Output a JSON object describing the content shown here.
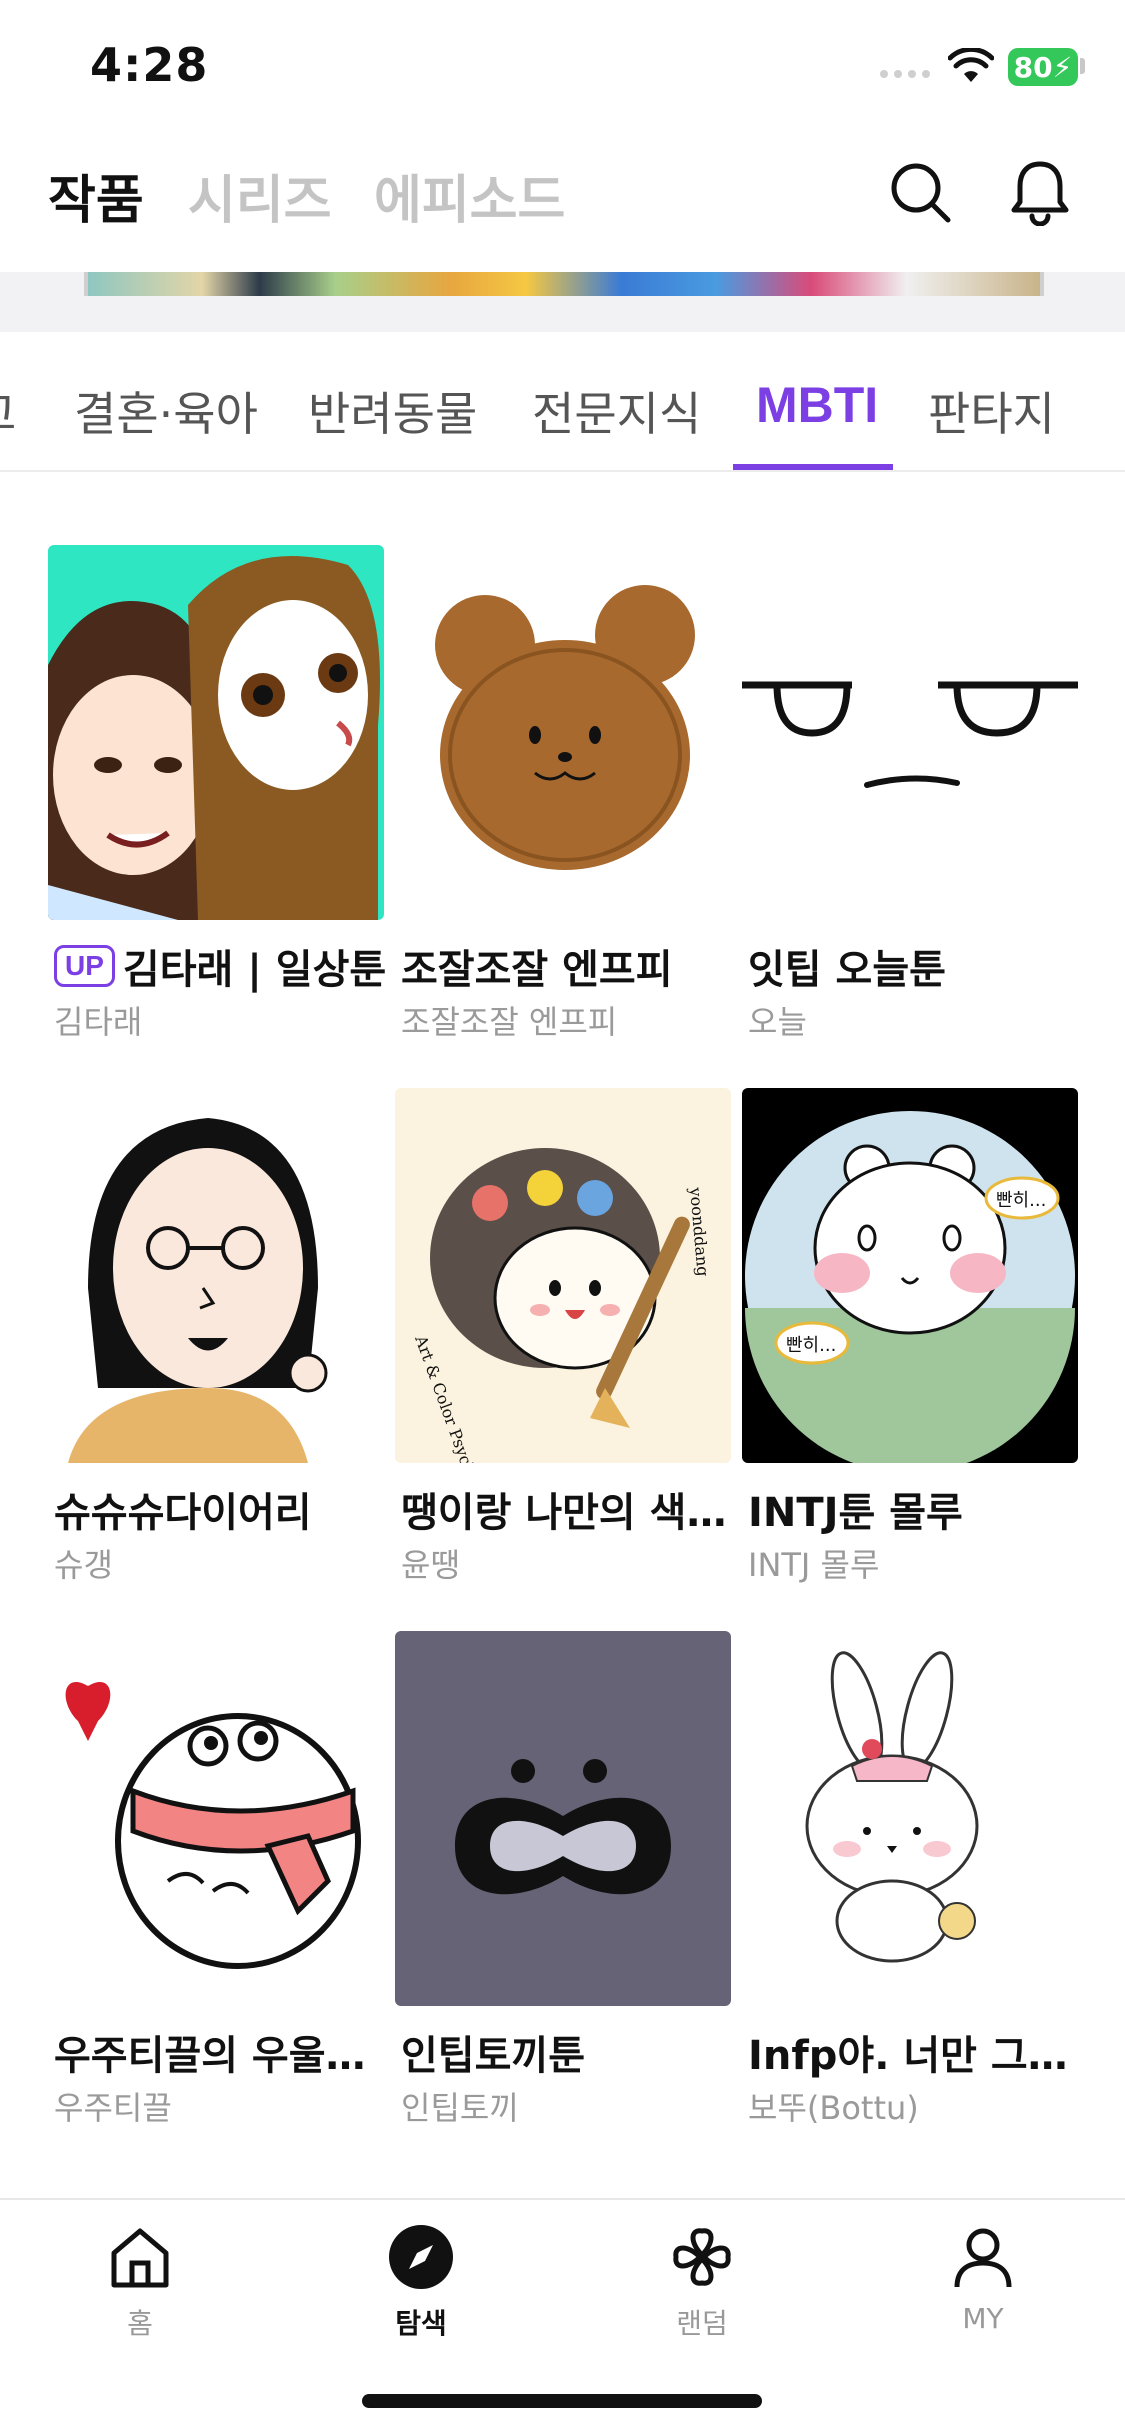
{
  "status": {
    "time": "4:28",
    "battery": "80"
  },
  "top_nav": {
    "tabs": [
      {
        "label": "작품",
        "active": true
      },
      {
        "label": "시리즈",
        "active": false
      },
      {
        "label": "에피소드",
        "active": false
      }
    ],
    "icons": [
      "search-icon",
      "bell-icon"
    ]
  },
  "categories": {
    "items": [
      {
        "label": "고",
        "active": false
      },
      {
        "label": "결혼·육아",
        "active": false
      },
      {
        "label": "반려동물",
        "active": false
      },
      {
        "label": "전문지식",
        "active": false
      },
      {
        "label": "MBTI",
        "active": true
      },
      {
        "label": "판타지",
        "active": false
      }
    ],
    "accent": "#7b3fe4"
  },
  "cards": [
    {
      "badge": "UP",
      "title": "김타래 | 일상툰",
      "author": "김타래"
    },
    {
      "title": "조잘조잘 엔프피",
      "author": "조잘조잘 엔프피"
    },
    {
      "title": "잇팁 오늘툰",
      "author": "오늘"
    },
    {
      "title": "슈슈슈다이어리",
      "author": "슈갱"
    },
    {
      "title": "땡이랑 나만의 색깔 찾기",
      "author": "윤땡"
    },
    {
      "title": "INTJ툰 몰루",
      "author": "INTJ 몰루"
    },
    {
      "title": "우주티끌의 우울한 일상",
      "author": "우주티끌"
    },
    {
      "title": "인팁토끼툰",
      "author": "인팁토끼"
    },
    {
      "title": "Infp야. 너만 그런 거 아니야",
      "author": "보뚜(Bottu)"
    }
  ],
  "thumb_text": {
    "card5_brand": "Art & Color Psychology with",
    "card5_name": "yoonddang",
    "card6_bubble": "빤히..."
  },
  "bottom_nav": {
    "items": [
      {
        "label": "홈",
        "icon": "home-icon",
        "active": false
      },
      {
        "label": "탐색",
        "icon": "compass-icon",
        "active": true
      },
      {
        "label": "랜덤",
        "icon": "clover-icon",
        "active": false
      },
      {
        "label": "MY",
        "icon": "person-icon",
        "active": false
      }
    ]
  }
}
